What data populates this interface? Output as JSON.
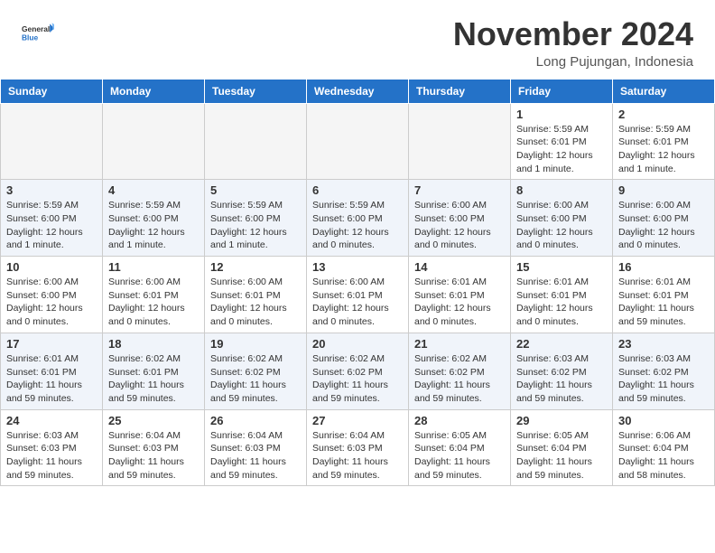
{
  "logo": {
    "line1": "General",
    "line2": "Blue"
  },
  "title": "November 2024",
  "location": "Long Pujungan, Indonesia",
  "weekdays": [
    "Sunday",
    "Monday",
    "Tuesday",
    "Wednesday",
    "Thursday",
    "Friday",
    "Saturday"
  ],
  "weeks": [
    [
      {
        "day": "",
        "info": ""
      },
      {
        "day": "",
        "info": ""
      },
      {
        "day": "",
        "info": ""
      },
      {
        "day": "",
        "info": ""
      },
      {
        "day": "",
        "info": ""
      },
      {
        "day": "1",
        "info": "Sunrise: 5:59 AM\nSunset: 6:01 PM\nDaylight: 12 hours and 1 minute."
      },
      {
        "day": "2",
        "info": "Sunrise: 5:59 AM\nSunset: 6:01 PM\nDaylight: 12 hours and 1 minute."
      }
    ],
    [
      {
        "day": "3",
        "info": "Sunrise: 5:59 AM\nSunset: 6:00 PM\nDaylight: 12 hours and 1 minute."
      },
      {
        "day": "4",
        "info": "Sunrise: 5:59 AM\nSunset: 6:00 PM\nDaylight: 12 hours and 1 minute."
      },
      {
        "day": "5",
        "info": "Sunrise: 5:59 AM\nSunset: 6:00 PM\nDaylight: 12 hours and 1 minute."
      },
      {
        "day": "6",
        "info": "Sunrise: 5:59 AM\nSunset: 6:00 PM\nDaylight: 12 hours and 0 minutes."
      },
      {
        "day": "7",
        "info": "Sunrise: 6:00 AM\nSunset: 6:00 PM\nDaylight: 12 hours and 0 minutes."
      },
      {
        "day": "8",
        "info": "Sunrise: 6:00 AM\nSunset: 6:00 PM\nDaylight: 12 hours and 0 minutes."
      },
      {
        "day": "9",
        "info": "Sunrise: 6:00 AM\nSunset: 6:00 PM\nDaylight: 12 hours and 0 minutes."
      }
    ],
    [
      {
        "day": "10",
        "info": "Sunrise: 6:00 AM\nSunset: 6:00 PM\nDaylight: 12 hours and 0 minutes."
      },
      {
        "day": "11",
        "info": "Sunrise: 6:00 AM\nSunset: 6:01 PM\nDaylight: 12 hours and 0 minutes."
      },
      {
        "day": "12",
        "info": "Sunrise: 6:00 AM\nSunset: 6:01 PM\nDaylight: 12 hours and 0 minutes."
      },
      {
        "day": "13",
        "info": "Sunrise: 6:00 AM\nSunset: 6:01 PM\nDaylight: 12 hours and 0 minutes."
      },
      {
        "day": "14",
        "info": "Sunrise: 6:01 AM\nSunset: 6:01 PM\nDaylight: 12 hours and 0 minutes."
      },
      {
        "day": "15",
        "info": "Sunrise: 6:01 AM\nSunset: 6:01 PM\nDaylight: 12 hours and 0 minutes."
      },
      {
        "day": "16",
        "info": "Sunrise: 6:01 AM\nSunset: 6:01 PM\nDaylight: 11 hours and 59 minutes."
      }
    ],
    [
      {
        "day": "17",
        "info": "Sunrise: 6:01 AM\nSunset: 6:01 PM\nDaylight: 11 hours and 59 minutes."
      },
      {
        "day": "18",
        "info": "Sunrise: 6:02 AM\nSunset: 6:01 PM\nDaylight: 11 hours and 59 minutes."
      },
      {
        "day": "19",
        "info": "Sunrise: 6:02 AM\nSunset: 6:02 PM\nDaylight: 11 hours and 59 minutes."
      },
      {
        "day": "20",
        "info": "Sunrise: 6:02 AM\nSunset: 6:02 PM\nDaylight: 11 hours and 59 minutes."
      },
      {
        "day": "21",
        "info": "Sunrise: 6:02 AM\nSunset: 6:02 PM\nDaylight: 11 hours and 59 minutes."
      },
      {
        "day": "22",
        "info": "Sunrise: 6:03 AM\nSunset: 6:02 PM\nDaylight: 11 hours and 59 minutes."
      },
      {
        "day": "23",
        "info": "Sunrise: 6:03 AM\nSunset: 6:02 PM\nDaylight: 11 hours and 59 minutes."
      }
    ],
    [
      {
        "day": "24",
        "info": "Sunrise: 6:03 AM\nSunset: 6:03 PM\nDaylight: 11 hours and 59 minutes."
      },
      {
        "day": "25",
        "info": "Sunrise: 6:04 AM\nSunset: 6:03 PM\nDaylight: 11 hours and 59 minutes."
      },
      {
        "day": "26",
        "info": "Sunrise: 6:04 AM\nSunset: 6:03 PM\nDaylight: 11 hours and 59 minutes."
      },
      {
        "day": "27",
        "info": "Sunrise: 6:04 AM\nSunset: 6:03 PM\nDaylight: 11 hours and 59 minutes."
      },
      {
        "day": "28",
        "info": "Sunrise: 6:05 AM\nSunset: 6:04 PM\nDaylight: 11 hours and 59 minutes."
      },
      {
        "day": "29",
        "info": "Sunrise: 6:05 AM\nSunset: 6:04 PM\nDaylight: 11 hours and 59 minutes."
      },
      {
        "day": "30",
        "info": "Sunrise: 6:06 AM\nSunset: 6:04 PM\nDaylight: 11 hours and 58 minutes."
      }
    ]
  ]
}
